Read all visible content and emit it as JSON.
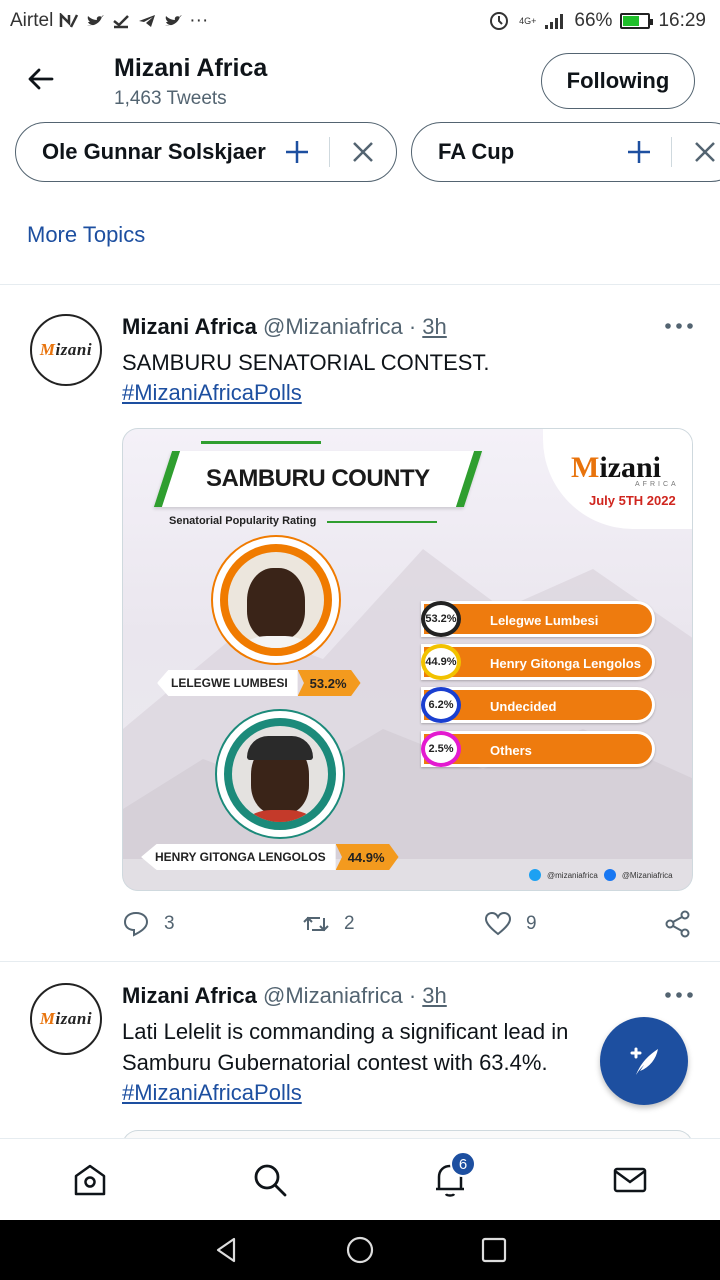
{
  "status_bar": {
    "carrier": "Airtel",
    "battery": "66%",
    "battery_level": 0.66,
    "time": "16:29",
    "network": "4G+"
  },
  "header": {
    "title": "Mizani Africa",
    "subtitle": "1,463 Tweets",
    "follow_label": "Following"
  },
  "topics": [
    {
      "label": "Ole Gunnar Solskjaer"
    },
    {
      "label": "FA Cup"
    }
  ],
  "more_topics": "More Topics",
  "tweets": [
    {
      "name": "Mizani Africa",
      "handle": "@Mizaniafrica",
      "dot": "·",
      "time": "3h",
      "text": "SAMBURU SENATORIAL CONTEST.",
      "hashtag": "#MizaniAfricaPolls",
      "replies": "3",
      "retweets": "2",
      "likes": "9",
      "card": {
        "county_title": "SAMBURU COUNTY",
        "rating_label": "Senatorial Popularity Rating",
        "brand": "izani",
        "brand_initial": "M",
        "brand_sub": "AFRICA",
        "date": "July 5TH 2022",
        "candidates": [
          {
            "name": "LELEGWE LUMBESI",
            "pct": "53.2%"
          },
          {
            "name": "HENRY GITONGA LENGOLOS",
            "pct": "44.9%"
          }
        ],
        "poll": [
          {
            "pct": "53.2%",
            "label": "Lelegwe Lumbesi",
            "ring_color": "#222222"
          },
          {
            "pct": "44.9%",
            "label": "Henry Gitonga Lengolos",
            "ring_color": "#f2c200"
          },
          {
            "pct": "6.2%",
            "label": "Undecided",
            "ring_color": "#1a3fd0"
          },
          {
            "pct": "2.5%",
            "label": "Others",
            "ring_color": "#e31ad0"
          }
        ],
        "social_twitter": "@mizaniafrica",
        "social_facebook": "@Mizaniafrica"
      }
    },
    {
      "name": "Mizani Africa",
      "handle": "@Mizaniafrica",
      "dot": "·",
      "time": "3h",
      "text": "Lati Lelelit is commanding a significant lead in Samburu Gubernatorial contest with 63.4%.",
      "hashtag": "#MizaniAfricaPolls"
    }
  ],
  "avatar_text": "izani",
  "avatar_initial": "M",
  "notifications_badge": "6",
  "colors": {
    "accent": "#1d4fa0",
    "brand_orange": "#ee7b0e",
    "brand_green": "#2f9e2f"
  }
}
